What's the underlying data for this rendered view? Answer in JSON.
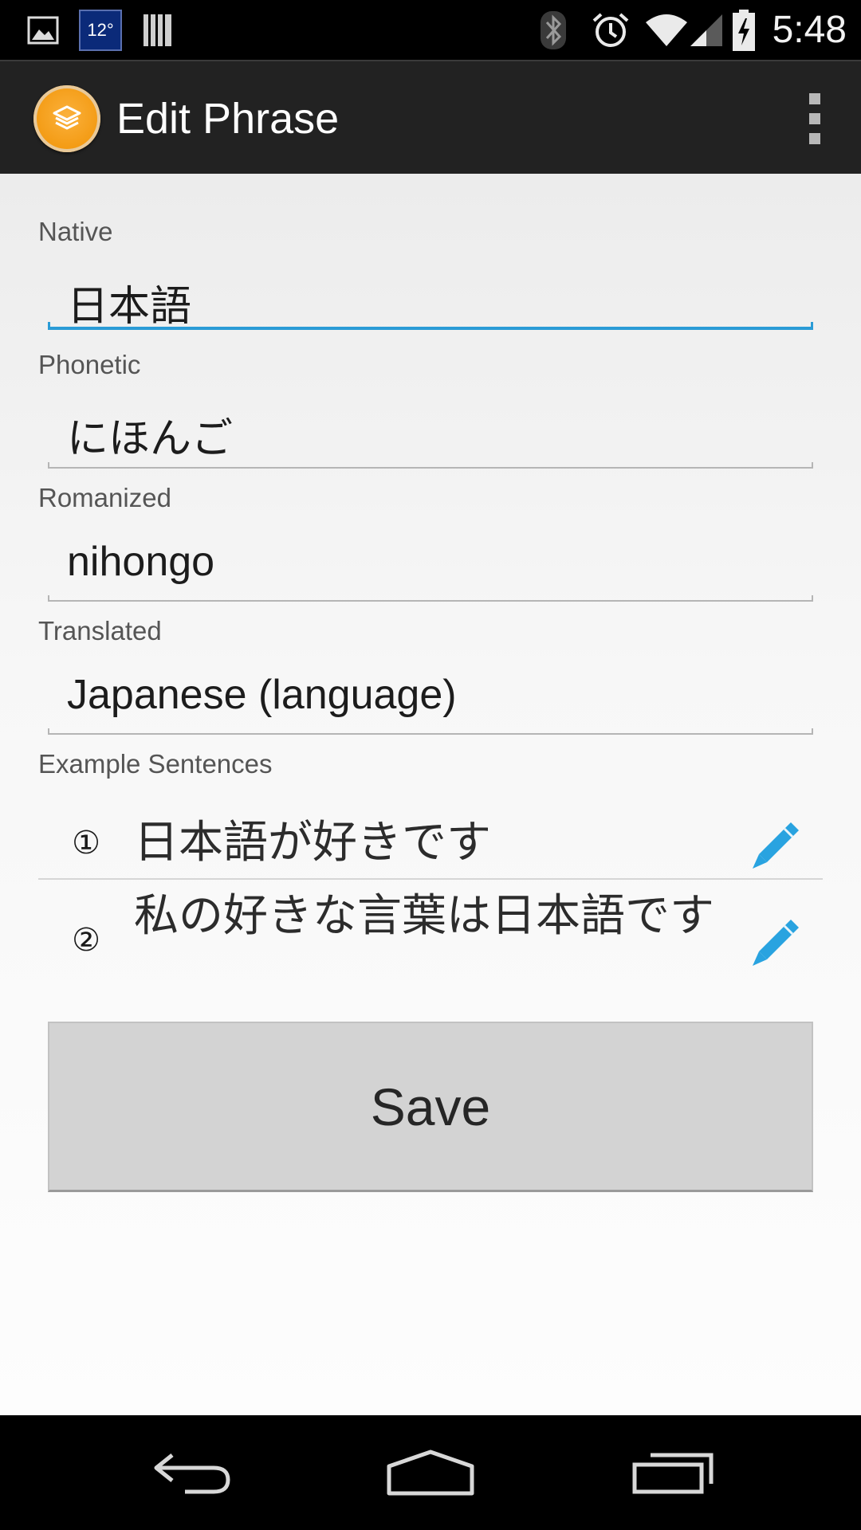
{
  "status_bar": {
    "weather_temp": "12°",
    "time": "5:48",
    "icons": [
      "image-icon",
      "weather-icon",
      "barcode-icon",
      "bluetooth-icon",
      "alarm-icon",
      "wifi-icon",
      "signal-icon",
      "battery-charging-icon"
    ]
  },
  "action_bar": {
    "title": "Edit Phrase",
    "app_icon": "layers-icon",
    "overflow_icon": "overflow-menu-icon"
  },
  "form": {
    "native": {
      "label": "Native",
      "value": "日本語"
    },
    "phonetic": {
      "label": "Phonetic",
      "value": "にほんご"
    },
    "romanized": {
      "label": "Romanized",
      "value": "nihongo"
    },
    "translated": {
      "label": "Translated",
      "value": "Japanese (language)"
    }
  },
  "examples": {
    "label": "Example Sentences",
    "items": [
      {
        "number": "①",
        "text": "日本語が好きです",
        "edit_icon": "pencil-icon"
      },
      {
        "number": "②",
        "text": "私の好きな言葉は日本語です",
        "edit_icon": "pencil-icon"
      }
    ]
  },
  "save_label": "Save",
  "nav_bar": {
    "icons": [
      "back-icon",
      "home-icon",
      "recents-icon"
    ]
  },
  "colors": {
    "accent": "#2a9bd6",
    "app_icon": "#f39a12",
    "action_bar": "#222222",
    "pencil": "#29a3e0"
  }
}
